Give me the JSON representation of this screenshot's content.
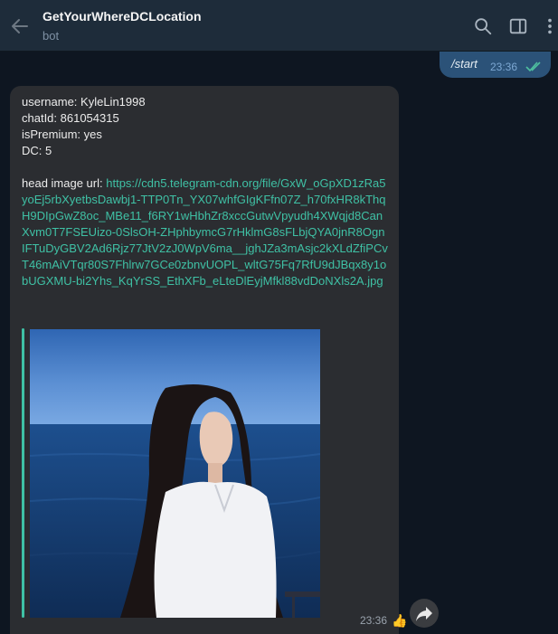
{
  "header": {
    "title": "GetYourWhereDCLocation",
    "subtitle": "bot"
  },
  "outgoing": {
    "text": "/start",
    "time": "23:36"
  },
  "incoming": {
    "lines": [
      "username: KyleLin1998",
      "chatId: 861054315",
      "isPremium: yes",
      "DC: 5"
    ],
    "url_label": "head image url: ",
    "url": "https://cdn5.telegram-cdn.org/file/GxW_oGpXD1zRa5yoEj5rbXyetbsDawbj1-TTP0Tn_YX07whfGIgKFfn07Z_h70fxHR8kThqH9DIpGwZ8oc_MBe11_f6RY1wHbhZr8xccGutwVpyudh4XWqjd8CanXvm0T7FSEUizo-0SlsOH-ZHphbymcG7rHklmG8sFLbjQYA0jnR8OgnIFTuDyGBV2Ad6Rjz77JtV2zJ0WpV6ma__jghJZa3mAsjc2kXLdZfiPCvT46mAiVTqr80S7Fhlrw7GCe0zbnvUOPL_wltG75Fq7RfU9dJBqx8y1obUGXMU-bi2Yhs_KqYrSS_EthXFb_eLteDlEyjMfkl88vdDoNXls2A.jpg",
    "time": "23:36",
    "reaction": "👍"
  },
  "icons": {
    "back": "arrow-left-icon",
    "search": "search-icon",
    "sidebar": "sidebar-toggle-icon",
    "menu": "more-vertical-icon",
    "forward": "forward-share-icon"
  },
  "colors": {
    "header_bg": "#1e2c3a",
    "chat_bg": "#0e1621",
    "outgoing_bubble": "#2b5278",
    "incoming_bubble": "#2b2d31",
    "link": "#3fc1a5"
  }
}
